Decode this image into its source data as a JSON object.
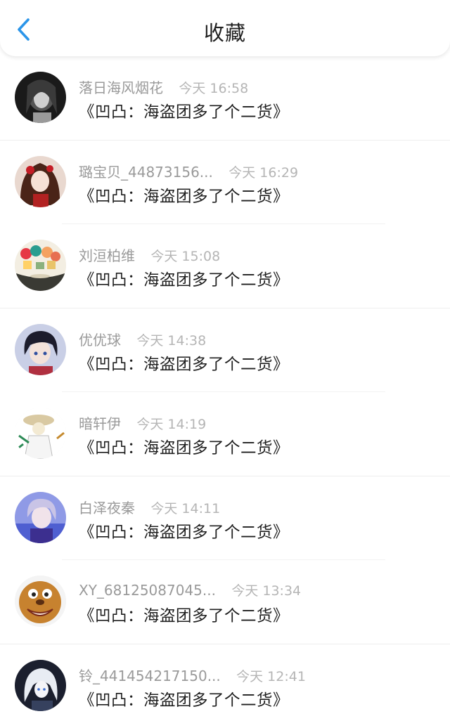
{
  "header": {
    "title": "收藏",
    "back_icon": "chevron-left-icon",
    "accent_color": "#2b95e9"
  },
  "items": [
    {
      "username": "落日海风烟花",
      "time": "今天 16:58",
      "text": "《凹凸：海盗团多了个二货》",
      "avatar": "anime-girl-monochrome"
    },
    {
      "username": "璐宝贝_44873156...",
      "time": "今天 16:29",
      "text": "《凹凸：海盗团多了个二货》",
      "avatar": "anime-girl-red"
    },
    {
      "username": "刘洹柏维",
      "time": "今天 15:08",
      "text": "《凹凸：海盗团多了个二货》",
      "avatar": "toy-figures"
    },
    {
      "username": "优优球",
      "time": "今天 14:38",
      "text": "《凹凸：海盗团多了个二货》",
      "avatar": "anime-boy-dark-hair"
    },
    {
      "username": "暗轩伊",
      "time": "今天 14:19",
      "text": "《凹凸：海盗团多了个二货》",
      "avatar": "sketch-character"
    },
    {
      "username": "白泽夜秦",
      "time": "今天 14:11",
      "text": "《凹凸：海盗团多了个二货》",
      "avatar": "anime-boy-purple"
    },
    {
      "username": "XY_68125087045...",
      "time": "今天 13:34",
      "text": "《凹凸：海盗团多了个二货》",
      "avatar": "cartoon-squirrel"
    },
    {
      "username": "铃_441454217150...",
      "time": "今天 12:41",
      "text": "《凹凸：海盗团多了个二货》",
      "avatar": "anime-white-hair"
    }
  ]
}
